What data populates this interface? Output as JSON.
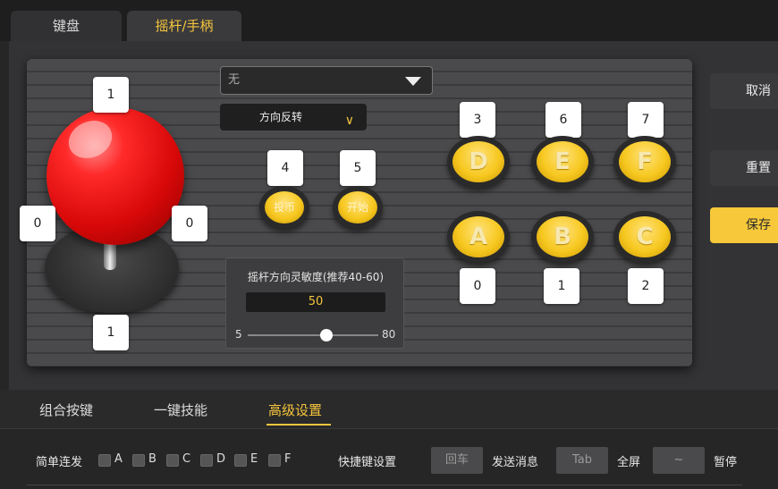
{
  "tabs": [
    {
      "label": "键盘",
      "active": false
    },
    {
      "label": "摇杆/手柄",
      "active": true
    }
  ],
  "joystick": {
    "up": "1",
    "down": "1",
    "left": "0",
    "right": "0"
  },
  "profile_dropdown": {
    "value": "无"
  },
  "reverse_dropdown": {
    "label": "方向反转"
  },
  "small_buttons": [
    {
      "label": "投币",
      "key": "4"
    },
    {
      "label": "开始",
      "key": "5"
    }
  ],
  "arcade_buttons": {
    "top": [
      {
        "label": "D",
        "key": "3"
      },
      {
        "label": "E",
        "key": "6"
      },
      {
        "label": "F",
        "key": "7"
      }
    ],
    "bottom": [
      {
        "label": "A",
        "key": "0"
      },
      {
        "label": "B",
        "key": "1"
      },
      {
        "label": "C",
        "key": "2"
      }
    ]
  },
  "sensitivity": {
    "title": "摇杆方向灵敏度(推荐40-60)",
    "value": 50,
    "min": 5,
    "max": 80
  },
  "side_buttons": {
    "cancel": "取消",
    "reset": "重置",
    "save": "保存"
  },
  "subtabs": [
    {
      "label": "组合按键",
      "active": false
    },
    {
      "label": "一键技能",
      "active": false
    },
    {
      "label": "高级设置",
      "active": true
    }
  ],
  "settings": {
    "rapid_fire_label": "简单连发",
    "rapid_fire_keys": [
      "A",
      "B",
      "C",
      "D",
      "E",
      "F"
    ],
    "hotkey_label": "快捷键设置",
    "hotkeys": [
      {
        "key": "回车",
        "action": "发送消息"
      },
      {
        "key": "Tab",
        "action": "全屏"
      },
      {
        "key": "~",
        "action": "暂停"
      }
    ]
  },
  "colors": {
    "accent": "#f5c53c",
    "joystick_ball": "#e01010",
    "arcade_button": "#f7c820"
  }
}
